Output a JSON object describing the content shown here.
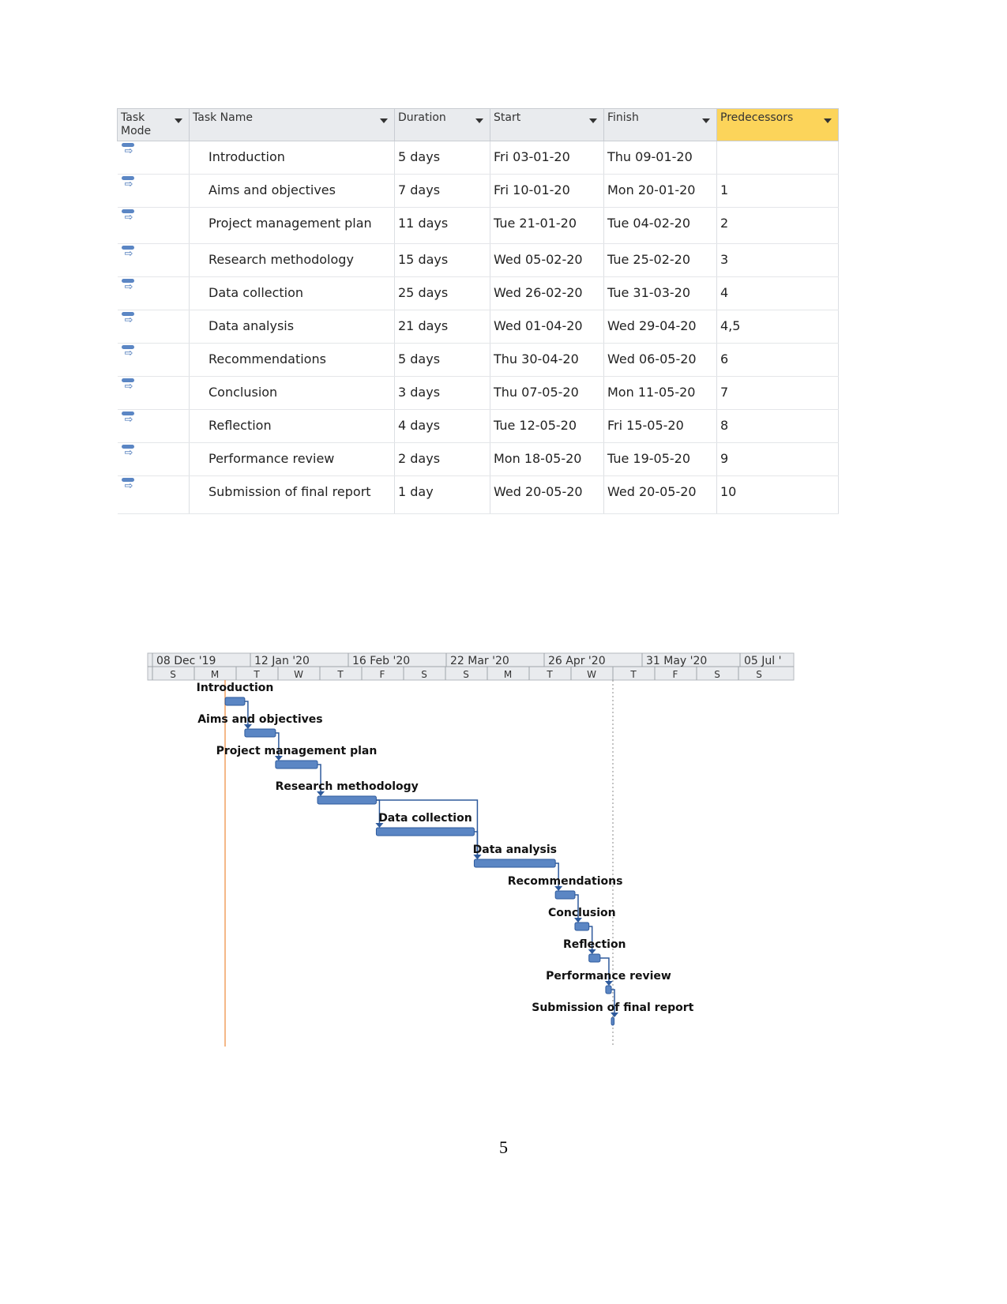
{
  "table": {
    "headers": {
      "mode": "Task Mode",
      "name": "Task Name",
      "duration": "Duration",
      "start": "Start",
      "finish": "Finish",
      "predecessors": "Predecessors"
    },
    "highlight_color": "#fcd45a",
    "rows": [
      {
        "name": "Introduction",
        "duration": "5 days",
        "start": "Fri 03-01-20",
        "finish": "Thu 09-01-20",
        "pred": ""
      },
      {
        "name": "Aims and objectives",
        "duration": "7 days",
        "start": "Fri 10-01-20",
        "finish": "Mon 20-01-20",
        "pred": "1"
      },
      {
        "name": "Project management plan",
        "duration": "11 days",
        "start": "Tue 21-01-20",
        "finish": "Tue 04-02-20",
        "pred": "2"
      },
      {
        "name": "Research methodology",
        "duration": "15 days",
        "start": "Wed 05-02-20",
        "finish": "Tue 25-02-20",
        "pred": "3"
      },
      {
        "name": "Data collection",
        "duration": "25 days",
        "start": "Wed 26-02-20",
        "finish": "Tue 31-03-20",
        "pred": "4"
      },
      {
        "name": "Data analysis",
        "duration": "21 days",
        "start": "Wed 01-04-20",
        "finish": "Wed 29-04-20",
        "pred": "4,5"
      },
      {
        "name": "Recommendations",
        "duration": "5 days",
        "start": "Thu 30-04-20",
        "finish": "Wed 06-05-20",
        "pred": "6"
      },
      {
        "name": "Conclusion",
        "duration": "3 days",
        "start": "Thu 07-05-20",
        "finish": "Mon 11-05-20",
        "pred": "7"
      },
      {
        "name": "Reflection",
        "duration": "4 days",
        "start": "Tue 12-05-20",
        "finish": "Fri 15-05-20",
        "pred": "8"
      },
      {
        "name": "Performance review",
        "duration": "2 days",
        "start": "Mon 18-05-20",
        "finish": "Tue 19-05-20",
        "pred": "9"
      },
      {
        "name": "Submission of final report",
        "duration": "1 day",
        "start": "Wed 20-05-20",
        "finish": "Wed 20-05-20",
        "pred": "10"
      }
    ]
  },
  "gantt": {
    "major_labels": [
      "08 Dec '19",
      "12 Jan '20",
      "16 Feb '20",
      "22 Mar '20",
      "26 Apr '20",
      "31 May '20",
      "05 Jul '"
    ],
    "minor_labels": [
      "S",
      "M",
      "T",
      "W",
      "T",
      "F",
      "S",
      "S",
      "M",
      "T",
      "W",
      "T",
      "F",
      "S",
      "S"
    ],
    "bar_color": "#5b86c4",
    "link_color": "#2e5a9c",
    "start_line_color": "#f0a060"
  },
  "page_number": "5"
}
